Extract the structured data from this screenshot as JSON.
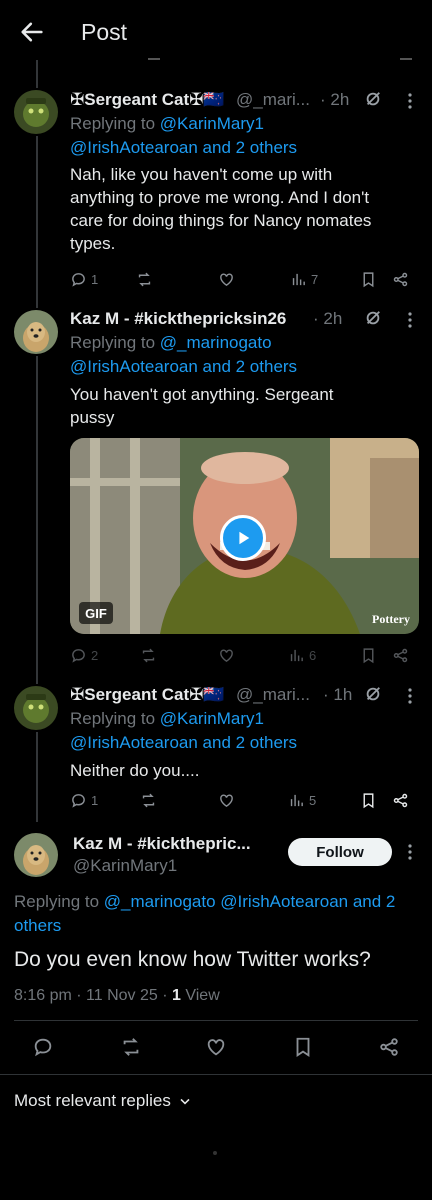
{
  "header": {
    "title": "Post"
  },
  "tweets": [
    {
      "name": "✠Sergeant Cat✠🇳🇿",
      "handle": "@_mari...",
      "time": "· 2h",
      "replying_prefix": "Replying to",
      "replying_line1": "@KarinMary1",
      "replying_line2": "@IrishAotearoan and 2 others",
      "text_lines": [
        "Nah, like you haven't come up with",
        "anything to prove me wrong. And I don't",
        "care for doing things for Nancy nomates",
        "types."
      ],
      "replies": "1",
      "views": "7"
    },
    {
      "name": "Kaz M - #kickthepricksin26",
      "time": "· 2h",
      "replying_prefix": "Replying to",
      "replying_line1": "@_marinogato",
      "replying_line2": "@IrishAotearoan and 2 others",
      "text_lines": [
        "You haven't got anything.  Sergeant",
        "pussy"
      ],
      "gif_label": "GIF",
      "watermark": "Pottery",
      "replies": "2",
      "views": "6"
    },
    {
      "name": "✠Sergeant Cat✠🇳🇿",
      "handle": "@_mari...",
      "time": "· 1h",
      "replying_prefix": "Replying to",
      "replying_line1": "@KarinMary1",
      "replying_line2": "@IrishAotearoan and 2 others",
      "text_lines": [
        "Neither do you...."
      ],
      "replies": "1",
      "views": "5"
    }
  ],
  "main": {
    "name": "Kaz M - #kickthepric...",
    "handle": "@KarinMary1",
    "follow_label": "Follow",
    "replying_prefix": "Replying to",
    "replying_line1": "@_marinogato @IrishAotearoan and 2",
    "replying_line2": "others",
    "text": "Do you even know how Twitter works?",
    "datetime": "8:16 pm · 11 Nov 25 · ",
    "views_count": "1",
    "views_label": " View"
  },
  "sort": {
    "label": "Most relevant replies"
  },
  "colors": {
    "accent": "#1d9bf0",
    "muted": "#71767b",
    "text": "#e7e9ea",
    "bg": "#000000"
  },
  "icons": [
    "back-arrow-icon",
    "reply-icon",
    "retweet-icon",
    "like-icon",
    "views-icon",
    "bookmark-icon",
    "share-icon",
    "grok-icon",
    "more-icon",
    "play-icon",
    "chevron-down-icon"
  ]
}
